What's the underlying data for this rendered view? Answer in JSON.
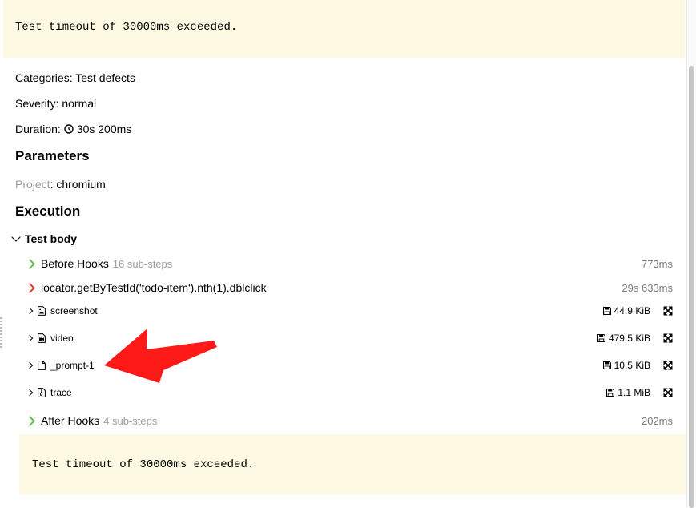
{
  "error_message": "Test timeout of 30000ms exceeded.",
  "meta": {
    "categories_label": "Categories:",
    "categories_value": "Test defects",
    "severity_label": "Severity:",
    "severity_value": "normal",
    "duration_label": "Duration:",
    "duration_value": "30s 200ms"
  },
  "parameters": {
    "title": "Parameters",
    "project_key": "Project",
    "project_value": "chromium"
  },
  "execution": {
    "title": "Execution",
    "test_body_label": "Test body",
    "steps": [
      {
        "name": "Before Hooks",
        "sub": "16 sub-steps",
        "duration": "773ms",
        "status": "passed"
      },
      {
        "name": "locator.getByTestId('todo-item').nth(1).dblclick",
        "sub": "",
        "duration": "29s 633ms",
        "status": "failed"
      },
      {
        "name": "After Hooks",
        "sub": "4 sub-steps",
        "duration": "202ms",
        "status": "passed"
      }
    ],
    "attachments": [
      {
        "name": "screenshot",
        "size": "44.9 KiB",
        "icon": "image-file-icon"
      },
      {
        "name": "video",
        "size": "479.5 KiB",
        "icon": "video-file-icon"
      },
      {
        "name": "_prompt-1",
        "size": "10.5 KiB",
        "icon": "text-file-icon"
      },
      {
        "name": "trace",
        "size": "1.1 MiB",
        "icon": "archive-file-icon"
      }
    ]
  },
  "colors": {
    "error_bg": "#fdf9e3",
    "passed": "#66bb50",
    "failed": "#e53b2c",
    "annotation_arrow": "#ff1a1a"
  }
}
